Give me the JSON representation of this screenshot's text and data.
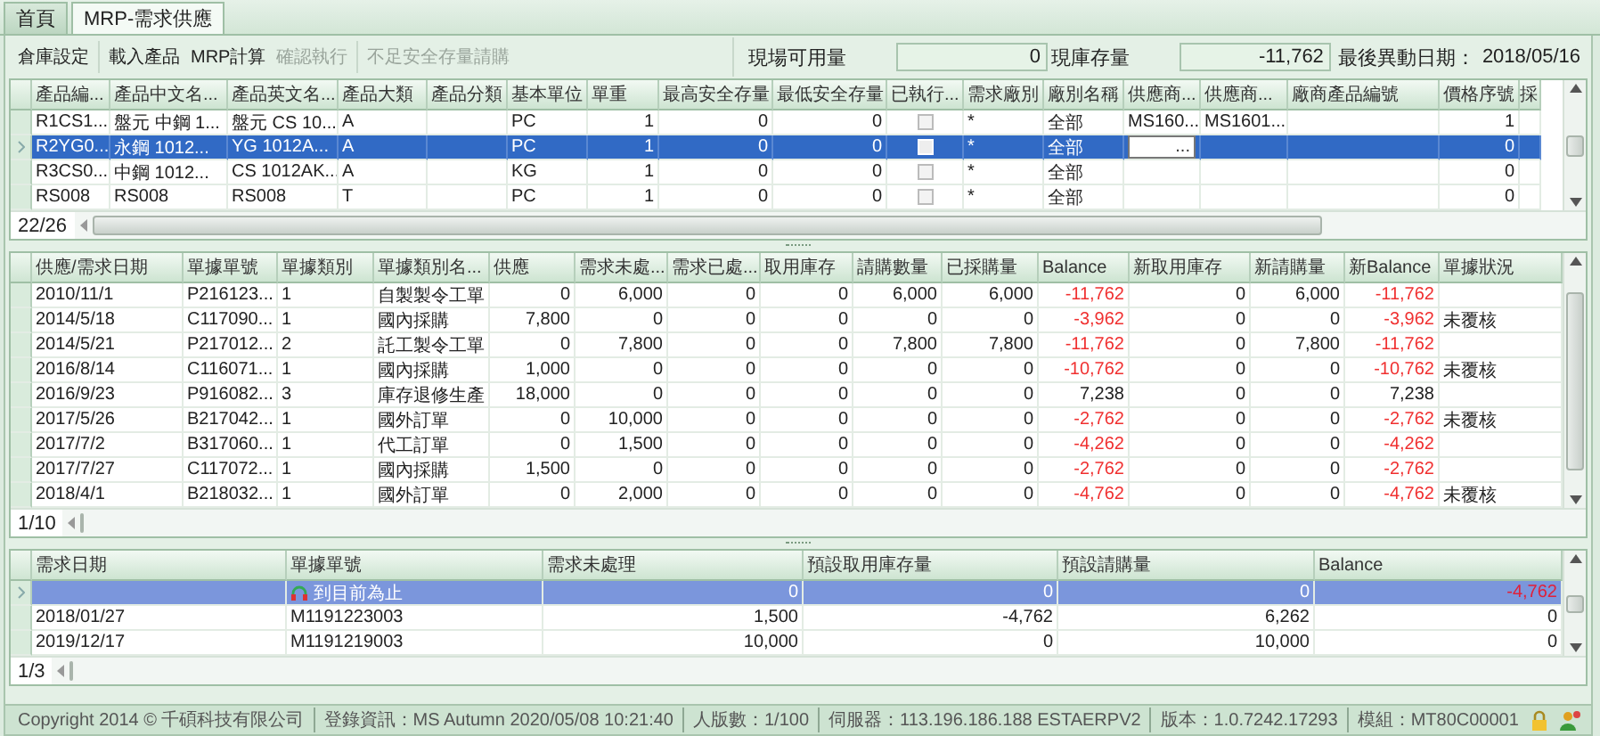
{
  "tabs": [
    {
      "label": "首頁",
      "selected": false
    },
    {
      "label": "MRP-需求供應",
      "selected": true
    }
  ],
  "toolbar": [
    [
      {
        "label": "倉庫設定",
        "disabled": false
      }
    ],
    [
      {
        "label": "載入產品",
        "disabled": false
      },
      {
        "label": "MRP計算",
        "disabled": false
      },
      {
        "label": "確認執行",
        "disabled": true
      }
    ],
    [
      {
        "label": "不足安全存量請購",
        "disabled": true
      }
    ]
  ],
  "stock": {
    "available_label": "現場可用量",
    "available_value": "0",
    "stock_label": "現庫存量",
    "stock_value": "-11,762",
    "last_change_label": "最後異動日期：",
    "last_change_value": "2018/05/16"
  },
  "product_grid": {
    "columns": [
      {
        "label": "產品編...",
        "kind": "text"
      },
      {
        "label": "產品中文名...",
        "kind": "text"
      },
      {
        "label": "產品英文名...",
        "kind": "text"
      },
      {
        "label": "產品大類",
        "kind": "text"
      },
      {
        "label": "產品分類",
        "kind": "text"
      },
      {
        "label": "基本單位",
        "kind": "text"
      },
      {
        "label": "單重",
        "kind": "number"
      },
      {
        "label": "最高安全存量",
        "kind": "number"
      },
      {
        "label": "最低安全存量",
        "kind": "number"
      },
      {
        "label": "已執行...",
        "kind": "check"
      },
      {
        "label": "需求廠別",
        "kind": "text"
      },
      {
        "label": "廠別名稱",
        "kind": "text"
      },
      {
        "label": "供應商...",
        "kind": "text"
      },
      {
        "label": "供應商...",
        "kind": "text"
      },
      {
        "label": "廠商產品編號",
        "kind": "text"
      },
      {
        "label": "價格序號",
        "kind": "number"
      },
      {
        "label": "採",
        "kind": "text"
      }
    ],
    "rows": [
      {
        "selected": false,
        "executed": false,
        "cells": [
          "R1CS1...",
          "盤元 中鋼 1...",
          "盤元 CS 10...",
          "A",
          null,
          "PC",
          "1",
          "0",
          "0",
          null,
          "*",
          "全部",
          "MS160...",
          "MS1601...",
          null,
          "1",
          null
        ]
      },
      {
        "selected": true,
        "executed": false,
        "cells": [
          "R2YG0...",
          "永鋼 1012...",
          "YG 1012A...",
          "A",
          null,
          "PC",
          "1",
          "0",
          "0",
          null,
          "*",
          "全部",
          {
            "kind": "editor",
            "text": "..."
          },
          null,
          null,
          "0",
          null
        ]
      },
      {
        "selected": false,
        "executed": false,
        "cells": [
          "R3CS0...",
          "中鋼 1012...",
          "CS 1012AK...",
          "A",
          null,
          "KG",
          "1",
          "0",
          "0",
          null,
          "*",
          "全部",
          null,
          null,
          null,
          "0",
          null
        ]
      },
      {
        "selected": false,
        "executed": false,
        "cells": [
          "RS008",
          "RS008",
          "RS008",
          "T",
          null,
          "PC",
          "1",
          "0",
          "0",
          null,
          "*",
          "全部",
          null,
          null,
          null,
          "0",
          null
        ]
      }
    ],
    "pager": "22/26"
  },
  "supply_grid": {
    "columns": [
      {
        "label": "供應/需求日期",
        "kind": "text"
      },
      {
        "label": "單據單號",
        "kind": "text"
      },
      {
        "label": "單據類別",
        "kind": "text"
      },
      {
        "label": "單據類別名...",
        "kind": "text"
      },
      {
        "label": "供應",
        "kind": "number"
      },
      {
        "label": "需求未處...",
        "kind": "number"
      },
      {
        "label": "需求已處...",
        "kind": "number"
      },
      {
        "label": "取用庫存",
        "kind": "number"
      },
      {
        "label": "請購數量",
        "kind": "number"
      },
      {
        "label": "已採購量",
        "kind": "number"
      },
      {
        "label": "Balance",
        "kind": "balance"
      },
      {
        "label": "新取用庫存",
        "kind": "number"
      },
      {
        "label": "新請購量",
        "kind": "number"
      },
      {
        "label": "新Balance",
        "kind": "balance"
      },
      {
        "label": "單據狀況",
        "kind": "text"
      }
    ],
    "rows": [
      {
        "shortage": true,
        "cells": [
          "2010/11/1",
          "P216123...",
          "1",
          "自製製令工單",
          "0",
          "6,000",
          "0",
          "0",
          "6,000",
          "6,000",
          "-11,762",
          "0",
          "6,000",
          "-11,762",
          null
        ]
      },
      {
        "shortage": true,
        "cells": [
          "2014/5/18",
          "C117090...",
          "1",
          "國內採購",
          "7,800",
          "0",
          "0",
          "0",
          "0",
          "0",
          "-3,962",
          "0",
          "0",
          "-3,962",
          "未覆核"
        ]
      },
      {
        "shortage": true,
        "cells": [
          "2014/5/21",
          "P217012...",
          "2",
          "託工製令工單",
          "0",
          "7,800",
          "0",
          "0",
          "7,800",
          "7,800",
          "-11,762",
          "0",
          "7,800",
          "-11,762",
          null
        ]
      },
      {
        "shortage": true,
        "cells": [
          "2016/8/14",
          "C116071...",
          "1",
          "國內採購",
          "1,000",
          "0",
          "0",
          "0",
          "0",
          "0",
          "-10,762",
          "0",
          "0",
          "-10,762",
          "未覆核"
        ]
      },
      {
        "shortage": false,
        "cells": [
          "2016/9/23",
          "P916082...",
          "3",
          "庫存退修生產",
          "18,000",
          "0",
          "0",
          "0",
          "0",
          "0",
          "7,238",
          "0",
          "0",
          "7,238",
          null
        ]
      },
      {
        "shortage": true,
        "cells": [
          "2017/5/26",
          "B217042...",
          "1",
          "國外訂單",
          "0",
          "10,000",
          "0",
          "0",
          "0",
          "0",
          "-2,762",
          "0",
          "0",
          "-2,762",
          "未覆核"
        ]
      },
      {
        "shortage": true,
        "cells": [
          "2017/7/2",
          "B317060...",
          "1",
          "代工訂單",
          "0",
          "1,500",
          "0",
          "0",
          "0",
          "0",
          "-4,262",
          "0",
          "0",
          "-4,262",
          null
        ]
      },
      {
        "shortage": true,
        "cells": [
          "2017/7/27",
          "C117072...",
          "1",
          "國內採購",
          "1,500",
          "0",
          "0",
          "0",
          "0",
          "0",
          "-2,762",
          "0",
          "0",
          "-2,762",
          null
        ]
      },
      {
        "shortage": true,
        "cells": [
          "2018/4/1",
          "B218032...",
          "1",
          "國外訂單",
          "0",
          "2,000",
          "0",
          "0",
          "0",
          "0",
          "-4,762",
          "0",
          "0",
          "-4,762",
          "未覆核"
        ]
      }
    ],
    "pager": "1/10"
  },
  "demand_grid": {
    "columns": [
      {
        "label": "需求日期",
        "kind": "text"
      },
      {
        "label": "單據單號",
        "kind": "text"
      },
      {
        "label": "需求未處理",
        "kind": "number"
      },
      {
        "label": "預設取用庫存量",
        "kind": "number"
      },
      {
        "label": "預設請購量",
        "kind": "number"
      },
      {
        "label": "Balance",
        "kind": "balance"
      }
    ],
    "rows": [
      {
        "selected": true,
        "shortage": true,
        "cells": [
          null,
          {
            "kind": "marker",
            "text": "到目前為止"
          },
          "0",
          "0",
          "0",
          "-4,762"
        ]
      },
      {
        "selected": false,
        "shortage": false,
        "cells": [
          "2018/01/27",
          "M1191223003",
          "1,500",
          "-4,762",
          "6,262",
          "0"
        ]
      },
      {
        "selected": false,
        "shortage": false,
        "cells": [
          "2019/12/17",
          "M1191219003",
          "10,000",
          "0",
          "10,000",
          "0"
        ]
      }
    ],
    "pager": "1/3"
  },
  "status_bar": [
    "Copyright 2014 © 千碩科技有限公司",
    "登錄資訊：MS Autumn 2020/05/08 10:21:40",
    "人版數：1/100",
    "伺服器：113.196.186.188 ESTAERPV2",
    "版本：1.0.7242.17293",
    "模組：MT80C00001"
  ]
}
